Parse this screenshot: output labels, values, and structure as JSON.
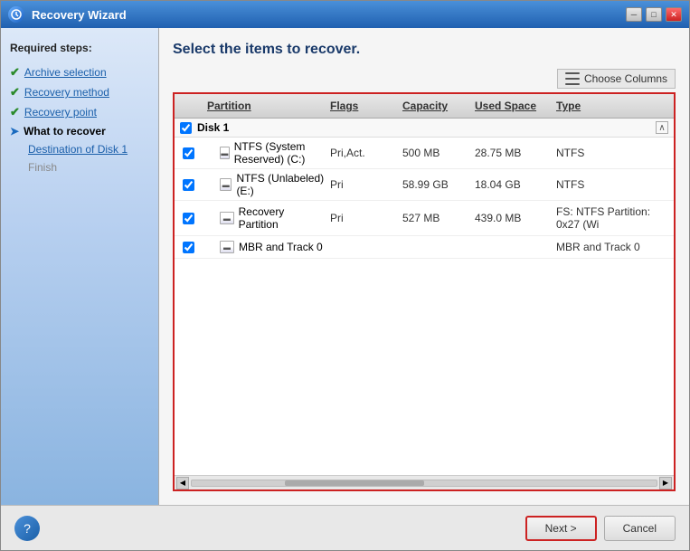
{
  "window": {
    "title": "Recovery Wizard",
    "min_btn": "─",
    "max_btn": "□",
    "close_btn": "✕"
  },
  "sidebar": {
    "heading": "Required steps:",
    "items": [
      {
        "id": "archive-selection",
        "label": "Archive selection",
        "state": "done"
      },
      {
        "id": "recovery-method",
        "label": "Recovery method",
        "state": "done"
      },
      {
        "id": "recovery-point",
        "label": "Recovery point",
        "state": "done"
      },
      {
        "id": "what-to-recover",
        "label": "What to recover",
        "state": "current"
      },
      {
        "id": "destination-disk1",
        "label": "Destination of Disk 1",
        "state": "link"
      },
      {
        "id": "finish",
        "label": "Finish",
        "state": "inactive"
      }
    ]
  },
  "main": {
    "title": "Select the items to recover.",
    "toolbar": {
      "choose_columns_label": "Choose Columns"
    },
    "table": {
      "columns": [
        {
          "id": "check",
          "label": ""
        },
        {
          "id": "partition",
          "label": "Partition"
        },
        {
          "id": "flags",
          "label": "Flags"
        },
        {
          "id": "capacity",
          "label": "Capacity"
        },
        {
          "id": "used_space",
          "label": "Used Space"
        },
        {
          "id": "type",
          "label": "Type"
        }
      ],
      "disk_groups": [
        {
          "id": "disk1",
          "label": "Disk 1",
          "checked": true,
          "collapsed": false,
          "partitions": [
            {
              "name": "NTFS (System Reserved) (C:)",
              "flags": "Pri,Act.",
              "capacity": "500 MB",
              "used_space": "28.75 MB",
              "type": "NTFS",
              "checked": true
            },
            {
              "name": "NTFS (Unlabeled) (E:)",
              "flags": "Pri",
              "capacity": "58.99 GB",
              "used_space": "18.04 GB",
              "type": "NTFS",
              "checked": true
            },
            {
              "name": "Recovery Partition",
              "flags": "Pri",
              "capacity": "527 MB",
              "used_space": "439.0 MB",
              "type": "FS: NTFS Partition: 0x27 (Wi",
              "checked": true
            },
            {
              "name": "MBR and Track 0",
              "flags": "",
              "capacity": "",
              "used_space": "",
              "type": "MBR and Track 0",
              "checked": true
            }
          ]
        }
      ]
    }
  },
  "footer": {
    "next_label": "Next >",
    "cancel_label": "Cancel",
    "help_icon": "?"
  }
}
